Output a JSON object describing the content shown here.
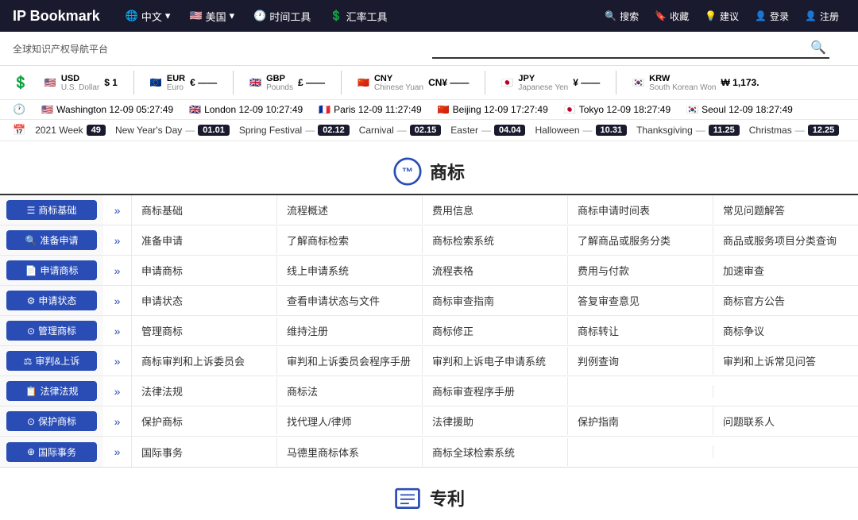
{
  "brand": "IP Bookmark",
  "nav": {
    "globe_icon": "🌐",
    "lang_label": "中文",
    "lang_dropdown": "▾",
    "us_flag": "🇺🇸",
    "region_label": "美国",
    "region_dropdown": "▾",
    "time_icon": "🕐",
    "time_label": "时间工具",
    "exchange_icon": "💲",
    "exchange_label": "汇率工具",
    "right_items": [
      {
        "icon": "🔍",
        "label": "搜索"
      },
      {
        "icon": "🔖",
        "label": "收藏"
      },
      {
        "icon": "💡",
        "label": "建议"
      },
      {
        "icon": "👤",
        "label": "登录"
      },
      {
        "icon": "👤",
        "label": "注册"
      }
    ]
  },
  "subtitle": "全球知识产权导航平台",
  "search_placeholder": "",
  "currencies": [
    {
      "code": "USD",
      "name": "U.S. Dollar",
      "symbol": "$",
      "value": "1",
      "flag": "🇺🇸"
    },
    {
      "code": "EUR",
      "name": "Euro",
      "symbol": "€",
      "value": "",
      "flag": "🇪🇺"
    },
    {
      "code": "GBP",
      "name": "Pounds",
      "symbol": "£",
      "value": "",
      "flag": "🇬🇧"
    },
    {
      "code": "CNY",
      "name": "Chinese Yuan",
      "symbol": "CN¥",
      "value": "",
      "flag": "🇨🇳"
    },
    {
      "code": "JPY",
      "name": "Japanese Yen",
      "symbol": "¥",
      "value": "",
      "flag": "🇯🇵"
    },
    {
      "code": "KRW",
      "name": "South Korean Won",
      "symbol": "₩",
      "value": "1,173.",
      "flag": "🇰🇷"
    }
  ],
  "clocks": [
    {
      "flag": "🇺🇸",
      "city": "Washington",
      "time": "12-09 05:27:49"
    },
    {
      "flag": "🇬🇧",
      "city": "London",
      "time": "12-09 10:27:49"
    },
    {
      "flag": "🇫🇷",
      "city": "Paris",
      "time": "12-09 11:27:49"
    },
    {
      "flag": "🇨🇳",
      "city": "Beijing",
      "time": "12-09 17:27:49"
    },
    {
      "flag": "🇯🇵",
      "city": "Tokyo",
      "time": "12-09 18:27:49"
    },
    {
      "flag": "🇰🇷",
      "city": "Seoul",
      "time": "12-09 18:27:49"
    }
  ],
  "calendar": {
    "week_label": "2021 Week",
    "week_num": "49",
    "holidays": [
      {
        "name": "New Year's Day",
        "dash": "—",
        "date": "01.01"
      },
      {
        "name": "Spring Festival",
        "dash": "—",
        "date": "02.12"
      },
      {
        "name": "Carnival",
        "dash": "—",
        "date": "02.15"
      },
      {
        "name": "Easter",
        "dash": "—",
        "date": "04.04"
      },
      {
        "name": "Halloween",
        "dash": "—",
        "date": "10.31"
      },
      {
        "name": "Thanksgiving",
        "dash": "—",
        "date": "11.25"
      },
      {
        "name": "Christmas",
        "dash": "—",
        "date": "12.25"
      }
    ]
  },
  "trademark_section": {
    "title": "商标",
    "categories": [
      {
        "icon": "☰",
        "label": "商标基础",
        "cells": [
          "商标基础",
          "流程概述",
          "费用信息",
          "商标申请时间表",
          "常见问题解答"
        ]
      },
      {
        "icon": "🔍",
        "label": "准备申请",
        "cells": [
          "准备申请",
          "了解商标检索",
          "商标检索系统",
          "了解商品或服务分类",
          "商品或服务项目分类查询"
        ]
      },
      {
        "icon": "📄",
        "label": "申请商标",
        "cells": [
          "申请商标",
          "线上申请系统",
          "流程表格",
          "费用与付款",
          "加速审查"
        ]
      },
      {
        "icon": "⚙",
        "label": "申请状态",
        "cells": [
          "申请状态",
          "查看申请状态与文件",
          "商标审查指南",
          "答复审查意见",
          "商标官方公告"
        ]
      },
      {
        "icon": "⊙",
        "label": "管理商标",
        "cells": [
          "管理商标",
          "维持注册",
          "商标修正",
          "商标转让",
          "商标争议"
        ]
      },
      {
        "icon": "⚖",
        "label": "审判&上诉",
        "cells": [
          "商标审判和上诉委员会",
          "审判和上诉委员会程序手册",
          "审判和上诉电子申请系统",
          "判例查询",
          "审判和上诉常见问答"
        ]
      },
      {
        "icon": "📋",
        "label": "法律法规",
        "cells": [
          "法律法规",
          "商标法",
          "商标审查程序手册",
          "",
          ""
        ]
      },
      {
        "icon": "⊙",
        "label": "保护商标",
        "cells": [
          "保护商标",
          "找代理人/律师",
          "法律援助",
          "保护指南",
          "问题联系人"
        ]
      },
      {
        "icon": "⊕",
        "label": "国际事务",
        "cells": [
          "国际事务",
          "马德里商标体系",
          "商标全球检索系统",
          "",
          ""
        ]
      }
    ]
  },
  "patent_section": {
    "title": "专利"
  }
}
